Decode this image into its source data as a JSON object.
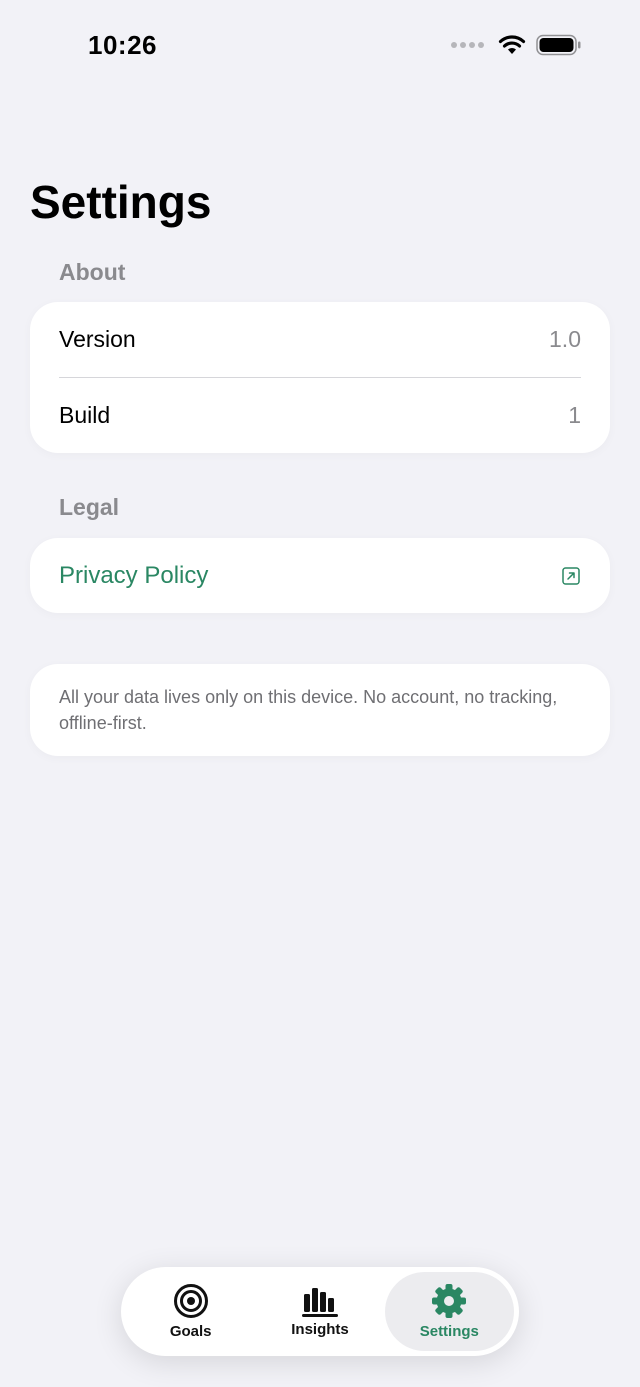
{
  "status_bar": {
    "time": "10:26"
  },
  "page_title": "Settings",
  "sections": {
    "about": {
      "header": "About",
      "rows": [
        {
          "label": "Version",
          "value": "1.0"
        },
        {
          "label": "Build",
          "value": "1"
        }
      ]
    },
    "legal": {
      "header": "Legal",
      "link_label": "Privacy Policy",
      "link_icon": "external-link-icon"
    }
  },
  "note": "All your data lives only on this device. No account, no tracking, offline-first.",
  "tabbar": {
    "tabs": [
      {
        "label": "Goals",
        "icon": "target-icon",
        "active": false
      },
      {
        "label": "Insights",
        "icon": "bar-chart-icon",
        "active": false
      },
      {
        "label": "Settings",
        "icon": "gear-icon",
        "active": true
      }
    ]
  },
  "colors": {
    "accent": "#2a8763",
    "background": "#f2f2f7",
    "secondary_text": "#8a8a8e"
  }
}
